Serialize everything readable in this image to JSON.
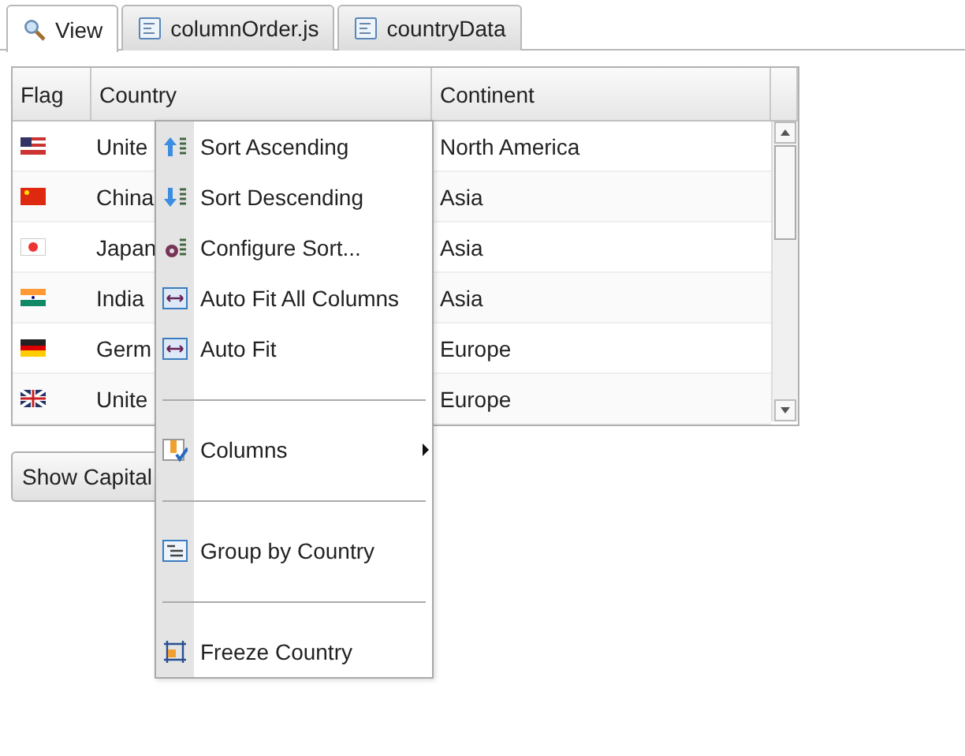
{
  "tabs": [
    {
      "label": "View",
      "selected": true
    },
    {
      "label": "columnOrder.js",
      "selected": false
    },
    {
      "label": "countryData",
      "selected": false
    }
  ],
  "grid": {
    "columns": [
      "Flag",
      "Country",
      "Continent"
    ],
    "rows": [
      {
        "country": "Unite",
        "continent": "North America"
      },
      {
        "country": "China",
        "continent": "Asia"
      },
      {
        "country": "Japan",
        "continent": "Asia"
      },
      {
        "country": "India",
        "continent": "Asia"
      },
      {
        "country": "Germ",
        "continent": "Europe"
      },
      {
        "country": "Unite",
        "continent": "Europe"
      }
    ]
  },
  "button": "Show Capital",
  "menu": [
    {
      "kind": "item",
      "label": "Sort Ascending"
    },
    {
      "kind": "item",
      "label": "Sort Descending"
    },
    {
      "kind": "item",
      "label": "Configure Sort..."
    },
    {
      "kind": "item",
      "label": "Auto Fit All Columns"
    },
    {
      "kind": "item",
      "label": "Auto Fit"
    },
    {
      "kind": "separator"
    },
    {
      "kind": "item",
      "label": "Columns",
      "submenu": true
    },
    {
      "kind": "separator"
    },
    {
      "kind": "item",
      "label": "Group by Country"
    },
    {
      "kind": "separator"
    },
    {
      "kind": "item",
      "label": "Freeze Country"
    }
  ]
}
